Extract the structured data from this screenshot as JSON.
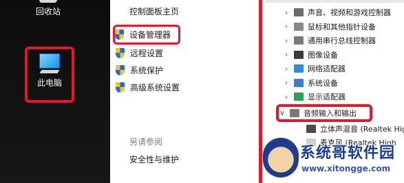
{
  "desktop": {
    "recycle_bin_label": "回收站",
    "this_pc_label": "此电脑"
  },
  "control_panel": {
    "home_link": "控制面板主页",
    "items": [
      {
        "label": "设备管理器",
        "icon": "shield-icon",
        "highlighted": true
      },
      {
        "label": "远程设置",
        "icon": "shield-icon",
        "highlighted": false
      },
      {
        "label": "系统保护",
        "icon": "shield-icon",
        "highlighted": false
      },
      {
        "label": "高级系统设置",
        "icon": "shield-icon",
        "highlighted": false
      }
    ],
    "see_also_heading": "另请参阅",
    "security_link": "安全性与维护"
  },
  "device_manager": {
    "rows": [
      {
        "label": "声音、视频和游戏控制器",
        "chevron": "›",
        "icon_color": "#6b6b6b"
      },
      {
        "label": "鼠标和其他指针设备",
        "chevron": "›",
        "icon_color": "#8a8a8a"
      },
      {
        "label": "通用串行总线控制器",
        "chevron": "›",
        "icon_color": "#7a7a7a"
      },
      {
        "label": "图像设备",
        "chevron": "›",
        "icon_color": "#3a3a3a"
      },
      {
        "label": "网络适配器",
        "chevron": "›",
        "icon_color": "#2f8fd8"
      },
      {
        "label": "系统设备",
        "chevron": "›",
        "icon_color": "#3a7fd0"
      },
      {
        "label": "显示适配器",
        "chevron": "›",
        "icon_color": "#2aa35a"
      },
      {
        "label": "音频输入和输出",
        "chevron": "∨",
        "icon_color": "#7a7a7a",
        "expanded": true
      },
      {
        "label": "立体声混音 (Realtek High",
        "chevron": "",
        "icon_color": "#4a4a4a",
        "child": true
      },
      {
        "label": "麦克风 (Realtek High",
        "chevron": "",
        "icon_color": "#d0d0d0",
        "child": true
      }
    ]
  },
  "watermark": {
    "title": "系统哥软件园",
    "url": "www.xitongge.com"
  },
  "colors": {
    "highlight_red": "#e3182d",
    "watermark_blue": "#1c3d96"
  }
}
